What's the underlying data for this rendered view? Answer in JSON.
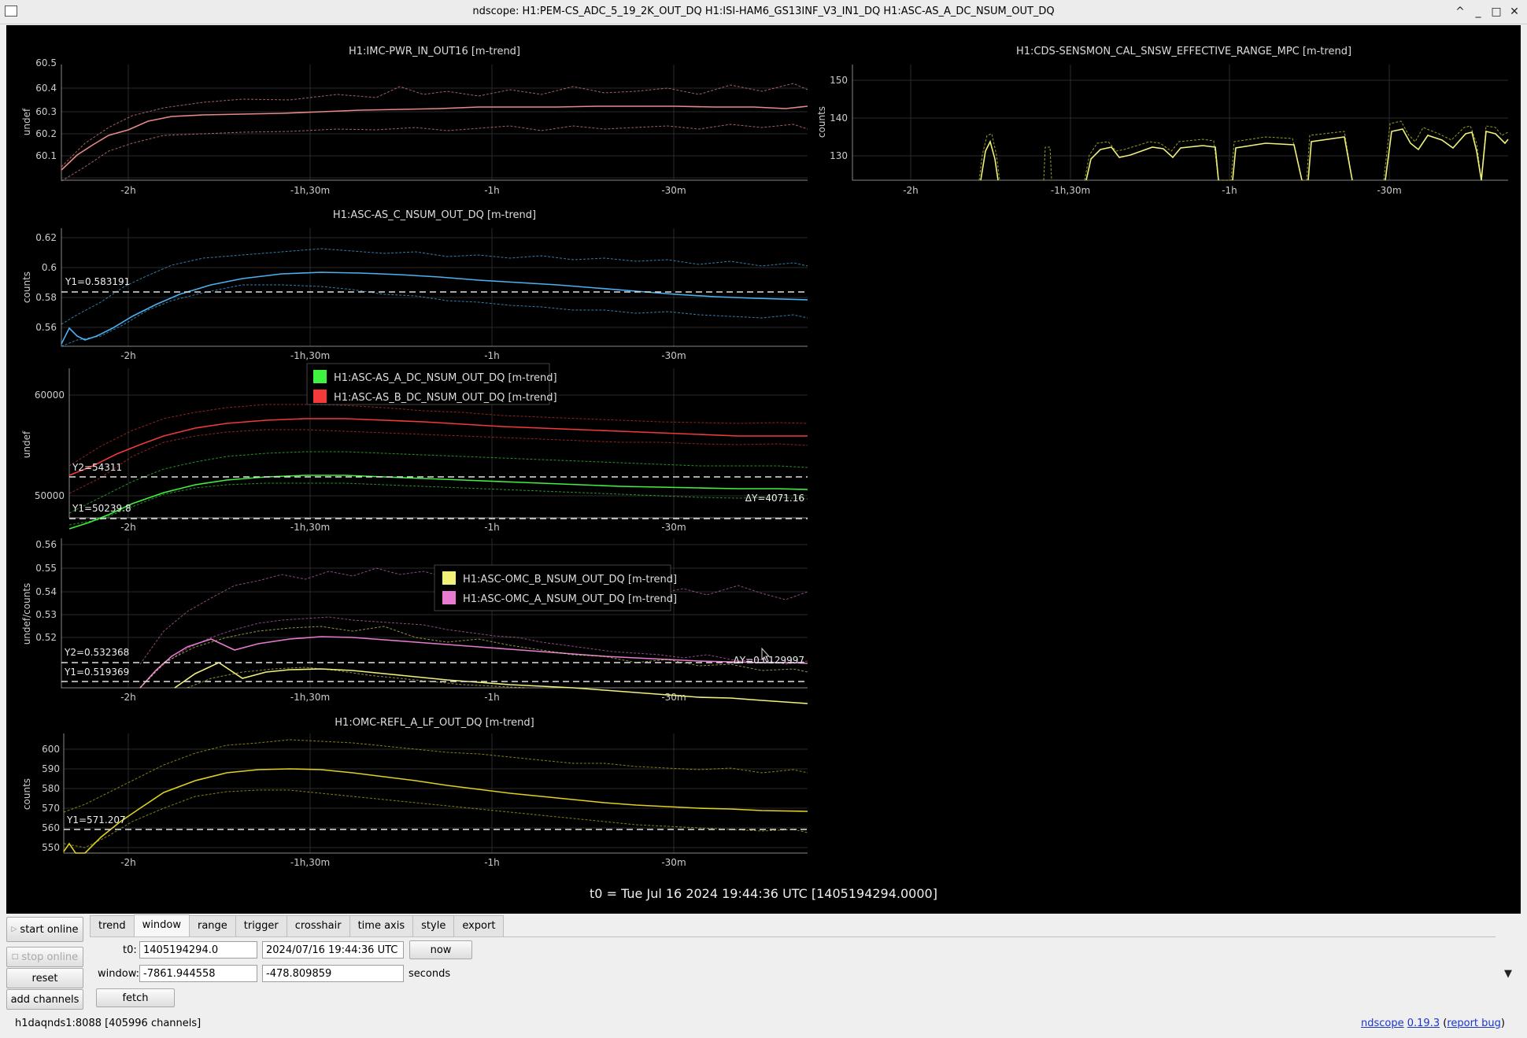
{
  "window": {
    "title": "ndscope: H1:PEM-CS_ADC_5_19_2K_OUT_DQ H1:ISI-HAM6_GS13INF_V3_IN1_DQ H1:ASC-AS_A_DC_NSUM_OUT_DQ",
    "controls": [
      "^",
      "_",
      "□",
      "✕"
    ]
  },
  "time_axis_ticks": [
    "-2h",
    "-1h,30m",
    "-1h",
    "-30m"
  ],
  "colors": {
    "background": "#000000",
    "green": "#3ff23f",
    "red": "#f23a3a",
    "yellow": "#f2f27a",
    "pink": "#e87ad2",
    "blue": "#4ab2f2",
    "olive": "#d6e02e",
    "gold": "#e0d020",
    "salmon": "#e78a87"
  },
  "plots": [
    {
      "id": "imc",
      "title": "H1:IMC-PWR_IN_OUT16 [m-trend]",
      "ylabel": "undef",
      "yticks": [
        "60.5",
        "60.4",
        "60.3",
        "60.2",
        "60.1"
      ]
    },
    {
      "id": "cds",
      "title": "H1:CDS-SENSMON_CAL_SNSW_EFFECTIVE_RANGE_MPC [m-trend]",
      "ylabel": "counts",
      "yticks": [
        "150",
        "140",
        "130"
      ]
    },
    {
      "id": "asc_c",
      "title": "H1:ASC-AS_C_NSUM_OUT_DQ [m-trend]",
      "ylabel": "counts",
      "yticks": [
        "0.62",
        "0.6",
        "0.58",
        "0.56"
      ],
      "cursors": {
        "y1": "Y1=0.583191"
      }
    },
    {
      "id": "asc_ab",
      "title": "",
      "ylabel": "undef",
      "yticks": [
        "60000",
        "50000"
      ],
      "legend": [
        "H1:ASC-AS_A_DC_NSUM_OUT_DQ [m-trend]",
        "H1:ASC-AS_B_DC_NSUM_OUT_DQ [m-trend]"
      ],
      "cursors": {
        "y2": "Y2=54311",
        "y1": "Y1=50239.8",
        "dy": "ΔY=4071.16"
      }
    },
    {
      "id": "omc",
      "title": "",
      "ylabel": "undef/counts",
      "yticks": [
        "0.56",
        "0.55",
        "0.54",
        "0.53",
        "0.52"
      ],
      "legend": [
        "H1:ASC-OMC_B_NSUM_OUT_DQ [m-trend]",
        "H1:ASC-OMC_A_NSUM_OUT_DQ [m-trend]"
      ],
      "cursors": {
        "y2": "Y2=0.532368",
        "y1": "Y1=0.519369",
        "dy": "ΔY=0.0129997"
      }
    },
    {
      "id": "refl",
      "title": "H1:OMC-REFL_A_LF_OUT_DQ [m-trend]",
      "ylabel": "counts",
      "yticks": [
        "600",
        "590",
        "580",
        "570",
        "560",
        "550"
      ],
      "cursors": {
        "y1": "Y1=571.207"
      }
    }
  ],
  "t0_label": "t0 = Tue Jul 16 2024 19:44:36 UTC [1405194294.0000]",
  "left_buttons": {
    "start_online": "start online",
    "stop_online": "stop online",
    "reset": "reset",
    "add_channels": "add channels"
  },
  "tabs": [
    "trend",
    "window",
    "range",
    "trigger",
    "crosshair",
    "time axis",
    "style",
    "export"
  ],
  "active_tab": "window",
  "window_tab": {
    "t0_label": "t0:",
    "t0_gps": "1405194294.0",
    "t0_utc": "2024/07/16 19:44:36 UTC",
    "now_label": "now",
    "window_label": "window:",
    "window_start": "-7861.944558",
    "window_end": "-478.809859",
    "seconds_label": "seconds",
    "fetch_label": "fetch"
  },
  "status": "h1daqnds1:8088  [405996 channels]",
  "version": {
    "name": "ndscope",
    "version": "0.19.3",
    "report": "report bug"
  }
}
